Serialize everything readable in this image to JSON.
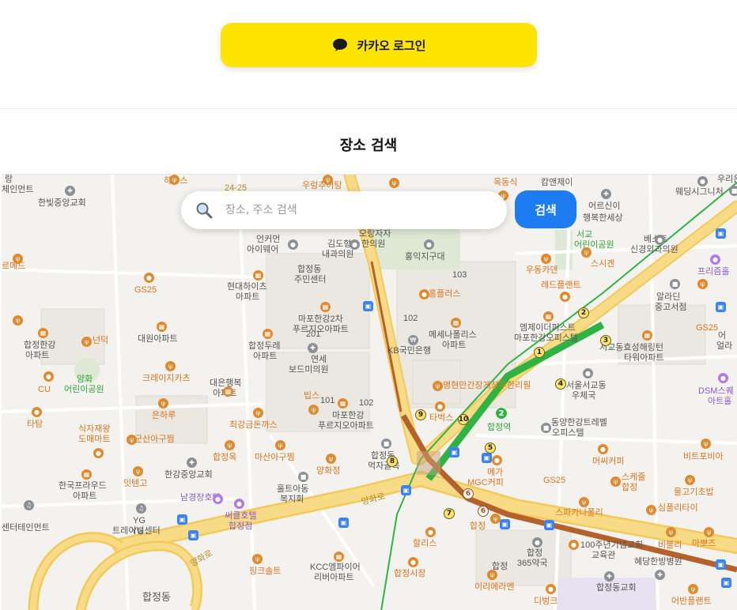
{
  "header": {
    "kakao_login_label": "카카오 로그인",
    "chat_icon": "chat-bubble-icon",
    "section_title": "장소 검색"
  },
  "search": {
    "placeholder": "장소, 주소 검색",
    "button_label": "검색",
    "icon": "search-icon"
  },
  "colors": {
    "kakao_yellow": "#fee500",
    "search_blue": "#1e7cf2",
    "road_yellow": "#f7d77c",
    "subway_green": "#2fb344",
    "subway_brown": "#b5622a"
  },
  "map": {
    "labels": [
      {
        "text": "하우스",
        "style": "orange"
      },
      {
        "text": "24-25",
        "style": "road"
      },
      {
        "text": "우렁추어탕",
        "style": "orange"
      },
      {
        "text": "옥동식",
        "style": "orange"
      },
      {
        "text": "캄앤제이",
        "style": "gray"
      },
      {
        "text": "우리은",
        "style": "gray"
      },
      {
        "text": "웨딩시그니처",
        "style": "gray"
      },
      {
        "text": "랑",
        "style": "gray"
      },
      {
        "text": "체인먼트",
        "style": "gray"
      },
      {
        "text": "한빛중앙교회",
        "style": "gray"
      },
      {
        "text": "어르신이",
        "style": "gray"
      },
      {
        "text": "행복한세상",
        "style": "gray"
      },
      {
        "text": "언커먼",
        "style": "gray"
      },
      {
        "text": "아이웨어",
        "style": "gray"
      },
      {
        "text": "김도형",
        "style": "gray"
      },
      {
        "text": "내과의원",
        "style": "gray"
      },
      {
        "text": "오랑자자",
        "style": "gray"
      },
      {
        "text": "한의원",
        "style": "gray"
      },
      {
        "text": "홍익지구대",
        "style": "gray"
      },
      {
        "text": "서교",
        "style": "green"
      },
      {
        "text": "어린이공원",
        "style": "green"
      },
      {
        "text": "베스트",
        "style": "gray"
      },
      {
        "text": "신경외과의원",
        "style": "gray"
      },
      {
        "text": "프리즘홀",
        "style": "purple"
      },
      {
        "text": "르메드",
        "style": "orange"
      },
      {
        "text": "합정동",
        "style": "gray"
      },
      {
        "text": "주민센터",
        "style": "gray"
      },
      {
        "text": "스시겐",
        "style": "orange"
      },
      {
        "text": "우동카덴",
        "style": "orange"
      },
      {
        "text": "GS25",
        "style": "orange"
      },
      {
        "text": "현대하이츠",
        "style": "gray"
      },
      {
        "text": "아파트",
        "style": "gray"
      },
      {
        "text": "103",
        "style": "gray"
      },
      {
        "text": "레드플랜트",
        "style": "orange"
      },
      {
        "text": "알라딘",
        "style": "gray"
      },
      {
        "text": "중고서점",
        "style": "gray"
      },
      {
        "text": "홈플러스",
        "style": "orange"
      },
      {
        "text": "마포한강2차",
        "style": "gray"
      },
      {
        "text": "푸르지오아파트",
        "style": "gray"
      },
      {
        "text": "102",
        "style": "gray"
      },
      {
        "text": "엠제이더퍼스트",
        "style": "gray"
      },
      {
        "text": "마포한강오피스텔",
        "style": "gray"
      },
      {
        "text": "GS25",
        "style": "orange"
      },
      {
        "text": "합정한강",
        "style": "gray"
      },
      {
        "text": "아파트",
        "style": "gray"
      },
      {
        "text": "대원아파트",
        "style": "gray"
      },
      {
        "text": "메세나폴리스",
        "style": "gray"
      },
      {
        "text": "아파트",
        "style": "gray"
      },
      {
        "text": "서교동효성해링턴",
        "style": "gray"
      },
      {
        "text": "타워아파트",
        "style": "gray"
      },
      {
        "text": "어",
        "style": "gray"
      },
      {
        "text": "얼라",
        "style": "gray"
      },
      {
        "text": "201",
        "style": "gray"
      },
      {
        "text": "합정두레",
        "style": "gray"
      },
      {
        "text": "아파트",
        "style": "gray"
      },
      {
        "text": "KB국민은행",
        "style": "gray"
      },
      {
        "text": "넌덕",
        "style": "orange"
      },
      {
        "text": "연세",
        "style": "gray"
      },
      {
        "text": "보드미의원",
        "style": "gray"
      },
      {
        "text": "크레이지카츠",
        "style": "orange"
      },
      {
        "text": "명현만간장게장무한리필",
        "style": "orange"
      },
      {
        "text": "서울서교동",
        "style": "gray"
      },
      {
        "text": "우체국",
        "style": "gray"
      },
      {
        "text": "DSM스퀘",
        "style": "purple"
      },
      {
        "text": "아트홀",
        "style": "purple"
      },
      {
        "text": "양화",
        "style": "green"
      },
      {
        "text": "어린이공원",
        "style": "green"
      },
      {
        "text": "CU",
        "style": "orange"
      },
      {
        "text": "대은행복",
        "style": "gray"
      },
      {
        "text": "아파트",
        "style": "gray"
      },
      {
        "text": "빕스",
        "style": "orange"
      },
      {
        "text": "101",
        "style": "gray"
      },
      {
        "text": "102",
        "style": "gray"
      },
      {
        "text": "타벅스",
        "style": "orange"
      },
      {
        "text": "동양한강트레벨",
        "style": "gray"
      },
      {
        "text": "오피스텔",
        "style": "gray"
      },
      {
        "text": "타탕",
        "style": "orange"
      },
      {
        "text": "은하루",
        "style": "orange"
      },
      {
        "text": "마포한강",
        "style": "gray"
      },
      {
        "text": "푸르지오아파트",
        "style": "gray"
      },
      {
        "text": "합정역",
        "style": "green"
      },
      {
        "text": "식자재왕",
        "style": "orange"
      },
      {
        "text": "도매마트",
        "style": "orange"
      },
      {
        "text": "최강금돈까스",
        "style": "orange"
      },
      {
        "text": "군산아구찜",
        "style": "orange"
      },
      {
        "text": "비트포비아",
        "style": "orange"
      },
      {
        "text": "머씨커피",
        "style": "orange"
      },
      {
        "text": "합정옥",
        "style": "orange"
      },
      {
        "text": "마산아구찜",
        "style": "orange"
      },
      {
        "text": "합정동",
        "style": "gray"
      },
      {
        "text": "먹자골목",
        "style": "gray"
      },
      {
        "text": "한국프라우드",
        "style": "gray"
      },
      {
        "text": "아파트",
        "style": "gray"
      },
      {
        "text": "잇텐고",
        "style": "orange"
      },
      {
        "text": "한강중앙교회",
        "style": "gray"
      },
      {
        "text": "양화정",
        "style": "orange"
      },
      {
        "text": "메가",
        "style": "orange"
      },
      {
        "text": "MGC커피",
        "style": "orange"
      },
      {
        "text": "GS25",
        "style": "orange"
      },
      {
        "text": "스케줄",
        "style": "orange"
      },
      {
        "text": "합정",
        "style": "orange"
      },
      {
        "text": "물고기초밥",
        "style": "orange"
      },
      {
        "text": "홀트아동",
        "style": "gray"
      },
      {
        "text": "복지회",
        "style": "gray"
      },
      {
        "text": "남경장호텔",
        "style": "purple"
      },
      {
        "text": "YG",
        "style": "gray"
      },
      {
        "text": "써클호텔",
        "style": "purple"
      },
      {
        "text": "합정점",
        "style": "purple"
      },
      {
        "text": "양화로",
        "style": "road"
      },
      {
        "text": "스파카나폴리",
        "style": "orange"
      },
      {
        "text": "심플리타이",
        "style": "orange"
      },
      {
        "text": "센터테인먼트",
        "style": "gray"
      },
      {
        "text": "YG",
        "style": "gray"
      },
      {
        "text": "트레이닝센터",
        "style": "gray"
      },
      {
        "text": "합정",
        "style": "orange"
      },
      {
        "text": "할리스",
        "style": "orange"
      },
      {
        "text": "합정",
        "style": "gray"
      },
      {
        "text": "365약국",
        "style": "gray"
      },
      {
        "text": "100주년기념교회",
        "style": "gray"
      },
      {
        "text": "교육관",
        "style": "gray"
      },
      {
        "text": "비블리",
        "style": "orange"
      },
      {
        "text": "마뽀즈",
        "style": "orange"
      },
      {
        "text": "양화로",
        "style": "road"
      },
      {
        "text": "핑크솔트",
        "style": "orange"
      },
      {
        "text": "KCC엠파이어",
        "style": "gray"
      },
      {
        "text": "리버아파트",
        "style": "gray"
      },
      {
        "text": "합정시장",
        "style": "orange"
      },
      {
        "text": "혜당한방병원",
        "style": "gray"
      },
      {
        "text": "이리에라멘",
        "style": "orange"
      },
      {
        "text": "합정동교회",
        "style": "gray"
      },
      {
        "text": "합정동",
        "style": "gray"
      },
      {
        "text": "디벙크",
        "style": "orange"
      },
      {
        "text": "어반플랜트",
        "style": "orange"
      },
      {
        "text": "합정",
        "style": "gray"
      }
    ],
    "subway_numbers": [
      "1",
      "2",
      "3",
      "4",
      "5",
      "6",
      "7",
      "8",
      "9",
      "10",
      "6"
    ],
    "line_badge": "2"
  }
}
